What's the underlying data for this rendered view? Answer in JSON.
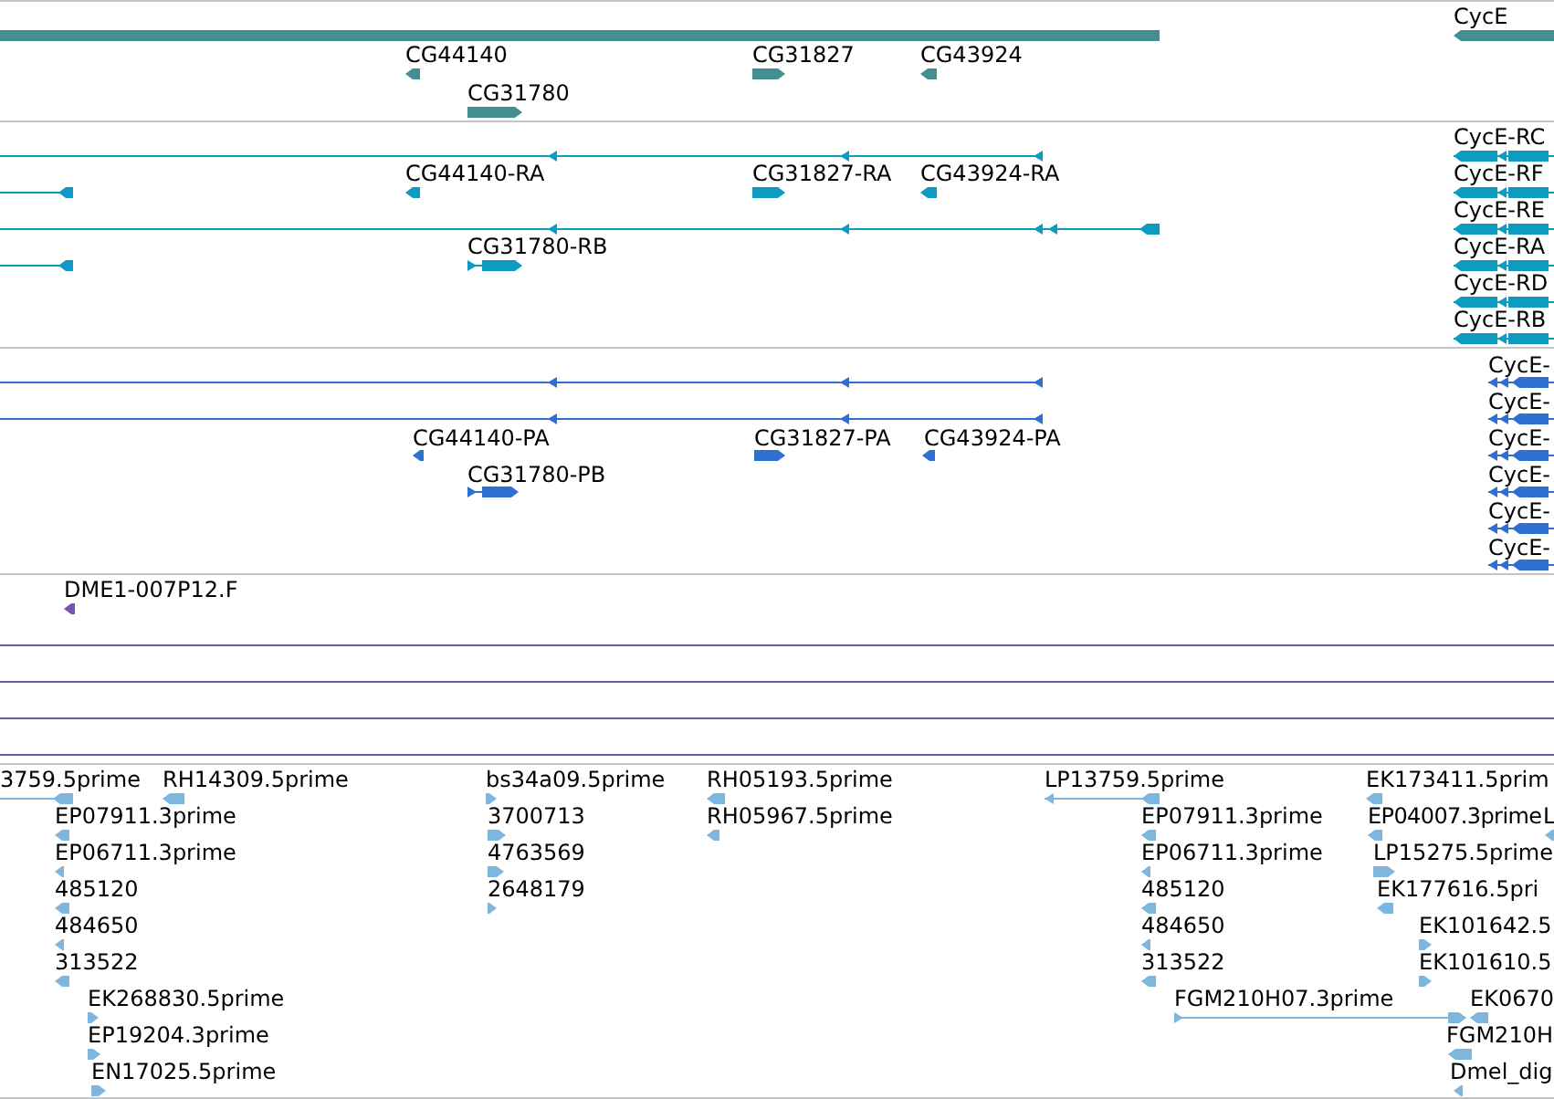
{
  "tracks": [
    {
      "color": "#428e91",
      "features": [
        {
          "label": "CycE",
          "reverse": true
        },
        {
          "label": "CG44140",
          "reverse": true
        },
        {
          "label": "CG31827",
          "reverse": false
        },
        {
          "label": "CG43924",
          "reverse": true
        },
        {
          "label": "CG31780",
          "reverse": false
        }
      ]
    },
    {
      "color": "#0e9bc2",
      "features": [
        {
          "reverse": true
        },
        {
          "label": "CycE-RC",
          "reverse": true
        },
        {
          "reverse": true
        },
        {
          "label": "CG44140-RA",
          "reverse": true
        },
        {
          "label": "CG31827-RA",
          "reverse": false
        },
        {
          "label": "CG43924-RA",
          "reverse": true
        },
        {
          "label": "CycE-RF",
          "reverse": true
        },
        {
          "reverse": true
        },
        {
          "label": "CycE-RE",
          "reverse": true
        },
        {
          "reverse": true
        },
        {
          "label": "CG31780-RB",
          "reverse": false
        },
        {
          "label": "CycE-RA",
          "reverse": true
        },
        {
          "label": "CycE-RD",
          "reverse": true
        },
        {
          "label": "CycE-RB",
          "reverse": true
        }
      ]
    },
    {
      "color": "#2f6fd1",
      "features": [
        {
          "reverse": true
        },
        {
          "label": "CycE-",
          "reverse": true
        },
        {
          "reverse": true
        },
        {
          "label": "CycE-",
          "reverse": true
        },
        {
          "label": "CG44140-PA",
          "reverse": true
        },
        {
          "label": "CG31827-PA",
          "reverse": false
        },
        {
          "label": "CG43924-PA",
          "reverse": true
        },
        {
          "label": "CycE-",
          "reverse": true
        },
        {
          "label": "CG31780-PB",
          "reverse": false
        },
        {
          "label": "CycE-",
          "reverse": true
        },
        {
          "label": "CycE-",
          "reverse": true
        },
        {
          "label": "CycE-",
          "reverse": true
        }
      ]
    },
    {
      "color": "#7355b1",
      "features": [
        {
          "label": "DME1-007P12.F",
          "reverse": true
        }
      ]
    },
    {
      "color": "#7fb6df",
      "features": [
        {
          "label": "3759.5prime",
          "reverse": true
        },
        {
          "label": "RH14309.5prime",
          "reverse": true
        },
        {
          "label": "bs34a09.5prime",
          "reverse": false
        },
        {
          "label": "RH05193.5prime",
          "reverse": true
        },
        {
          "label": "LP13759.5prime",
          "reverse": true
        },
        {
          "label": "EK173411.5prim",
          "reverse": true
        },
        {
          "label": "EP07911.3prime",
          "reverse": true
        },
        {
          "label": "3700713",
          "reverse": false
        },
        {
          "label": "RH05967.5prime",
          "reverse": true
        },
        {
          "label": "EP07911.3prime",
          "reverse": true
        },
        {
          "label": "EP04007.3prime",
          "reverse": true
        },
        {
          "label": "L",
          "reverse": true
        },
        {
          "label": "EP06711.3prime",
          "reverse": true
        },
        {
          "label": "4763569",
          "reverse": false
        },
        {
          "label": "EP06711.3prime",
          "reverse": true
        },
        {
          "label": "LP15275.5prime",
          "reverse": false
        },
        {
          "label": "485120",
          "reverse": true
        },
        {
          "label": "2648179",
          "reverse": false
        },
        {
          "label": "485120",
          "reverse": true
        },
        {
          "label": "EK177616.5pri",
          "reverse": true
        },
        {
          "label": "484650",
          "reverse": true
        },
        {
          "label": "484650",
          "reverse": true
        },
        {
          "label": "EK101642.5",
          "reverse": false
        },
        {
          "label": "313522",
          "reverse": true
        },
        {
          "label": "313522",
          "reverse": true
        },
        {
          "label": "EK101610.5",
          "reverse": false
        },
        {
          "label": "EK268830.5prime",
          "reverse": false
        },
        {
          "label": "FGM210H07.3prime",
          "reverse": false
        },
        {
          "label": "EK0670",
          "reverse": true
        },
        {
          "label": "EP19204.3prime",
          "reverse": false
        },
        {
          "label": "FGM210H",
          "reverse": true
        },
        {
          "label": "EN17025.5prime",
          "reverse": false
        },
        {
          "label": "Dmel_dig",
          "reverse": true
        }
      ]
    }
  ]
}
